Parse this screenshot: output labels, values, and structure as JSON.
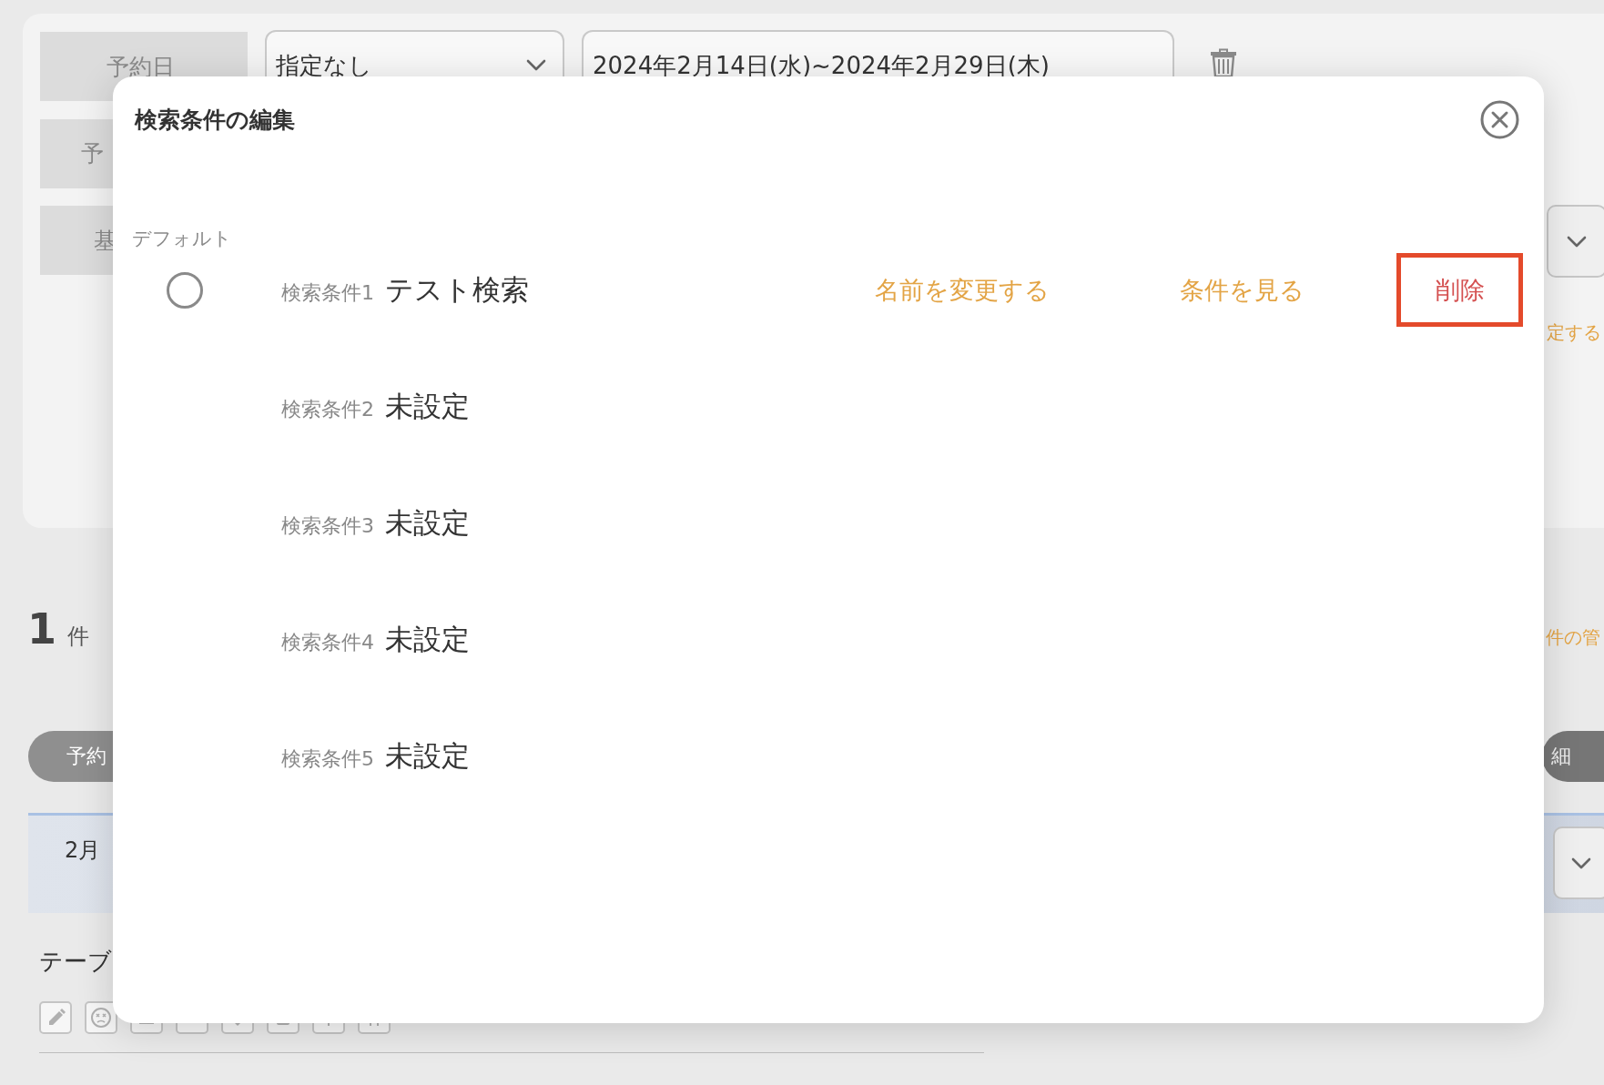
{
  "background": {
    "filter_labels": [
      "予約日",
      "予",
      "基"
    ],
    "date_select": {
      "value": "指定なし"
    },
    "date_range": {
      "value": "2024年2月14日(水)~2024年2月29日(木)"
    },
    "specify_link": "定する",
    "result_count": {
      "number": "1",
      "unit": "件"
    },
    "manage_link": "件の管",
    "left_pill": "予約",
    "right_pill": "細",
    "month_band": {
      "label": "2月"
    },
    "table_label": "テーブ"
  },
  "dialog": {
    "title": "検索条件の編集",
    "default_label": "デフォルト",
    "conditions": [
      {
        "label": "検索条件1",
        "name": "テスト検索",
        "radio": {
          "selected": false
        },
        "actions": [
          {
            "label": "名前を変更する",
            "kind": "link",
            "highlighted": false
          },
          {
            "label": "条件を見る",
            "kind": "link",
            "highlighted": false
          },
          {
            "label": "削除",
            "kind": "delete",
            "highlighted": true
          }
        ]
      },
      {
        "label": "検索条件2",
        "name": "未設定"
      },
      {
        "label": "検索条件3",
        "name": "未設定"
      },
      {
        "label": "検索条件4",
        "name": "未設定"
      },
      {
        "label": "検索条件5",
        "name": "未設定"
      }
    ]
  }
}
